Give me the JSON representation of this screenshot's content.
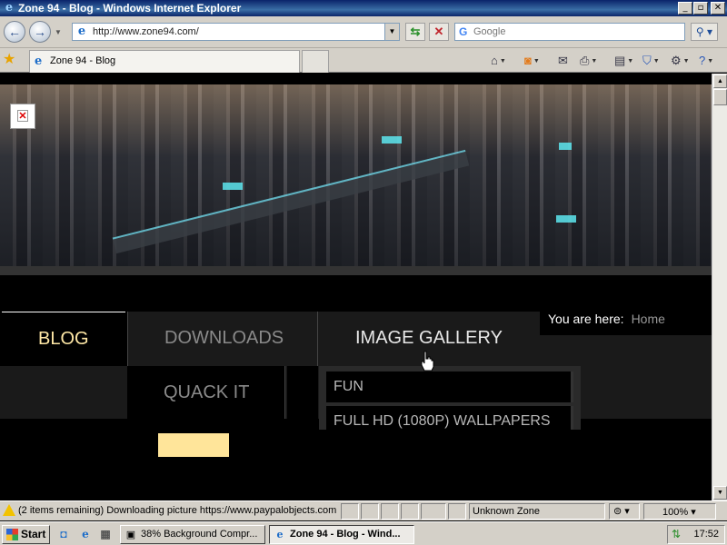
{
  "window": {
    "title": "Zone 94 - Blog - Windows Internet Explorer",
    "minimize": "_",
    "maximize": "▫",
    "close": "✕"
  },
  "address": {
    "url": "http://www.zone94.com/",
    "search_placeholder": "Google",
    "search_engine_letter": "G"
  },
  "tabs": [
    {
      "label": "Zone 94 - Blog",
      "active": true
    }
  ],
  "page": {
    "nav": {
      "blog": "BLOG",
      "downloads": "DOWNLOADS",
      "image_gallery": "IMAGE GALLERY",
      "quack_it": "QUACK IT"
    },
    "breadcrumb": {
      "label": "You are here:",
      "home": "Home"
    },
    "submenu": [
      {
        "label": "FUN"
      },
      {
        "label": "FULL HD (1080P) WALLPAPERS"
      }
    ],
    "broken_image_glyph": "✕"
  },
  "statusbar": {
    "message": "(2 items remaining) Downloading picture https://www.paypalobjects.com",
    "zone": "Unknown Zone",
    "zoom": "100%"
  },
  "taskbar": {
    "start": "Start",
    "tasks": [
      {
        "label": "38% Background Compr..."
      },
      {
        "label": "Zone 94 - Blog - Wind..."
      }
    ],
    "clock": "17:52"
  },
  "colors": {
    "nav_active_text": "#ffe8a6",
    "nav_inactive_text": "#8a8a8a",
    "nav_hover_text": "#e8e8e8",
    "highlight_bar": "#ffe59a",
    "title_bar": "#0a246a"
  }
}
